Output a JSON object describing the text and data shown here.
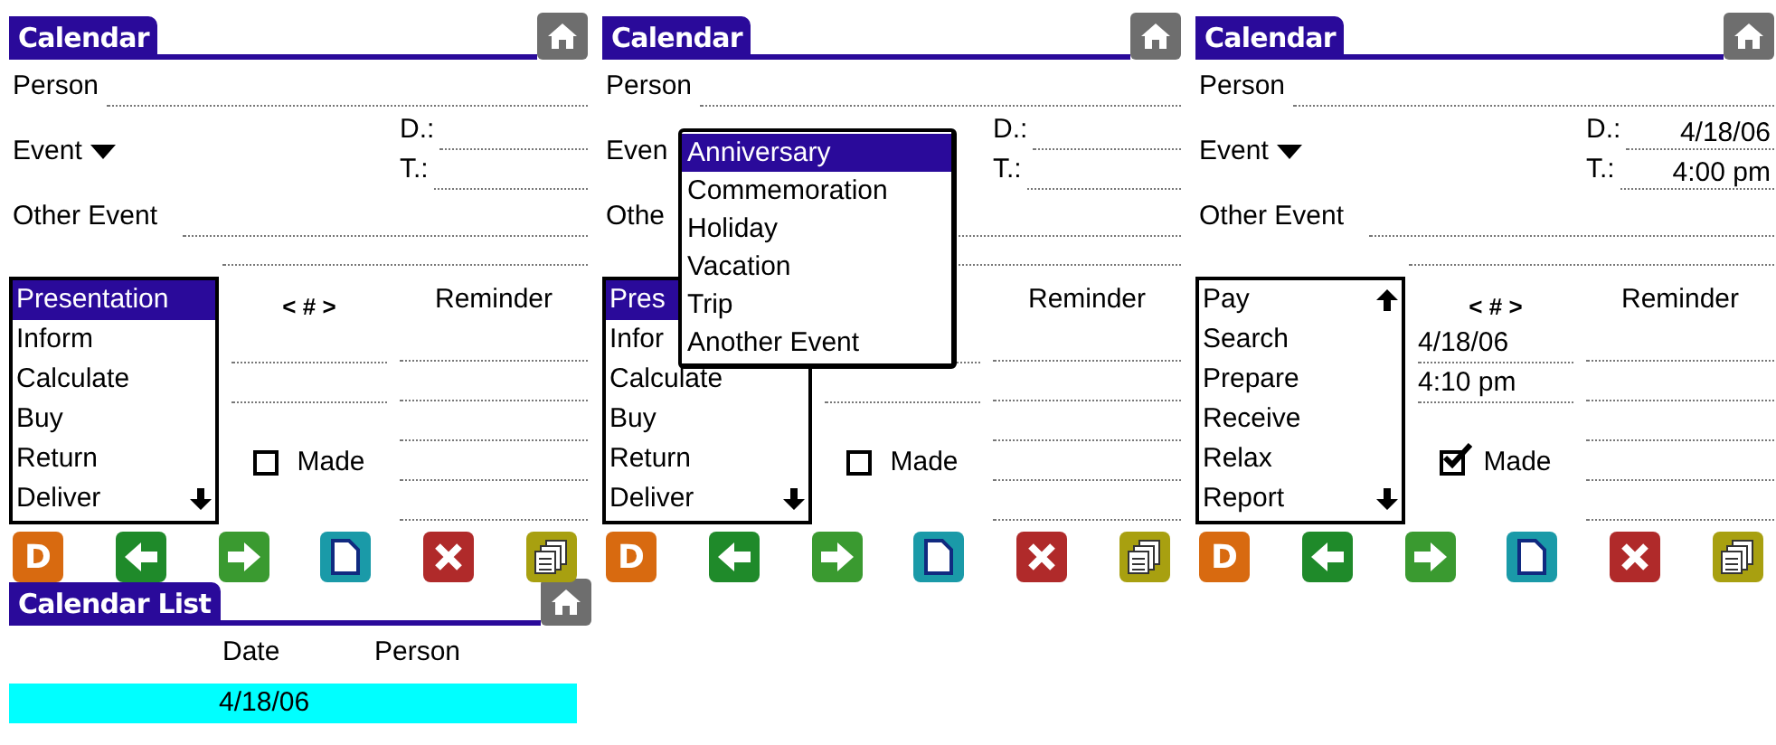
{
  "panels": [
    {
      "title": "Calendar",
      "person_label": "Person",
      "event_label": "Event",
      "event_arrow": true,
      "date_label": "D.:",
      "time_label": "T.:",
      "other_event_label": "Other Event",
      "counter": "< # >",
      "reminder_label": "Reminder",
      "made": {
        "label": "Made",
        "checked": false
      },
      "list": {
        "scroll_up": false,
        "scroll_down": true,
        "items": [
          {
            "label": "Presentation",
            "selected": true
          },
          {
            "label": "Inform",
            "selected": false
          },
          {
            "label": "Calculate",
            "selected": false
          },
          {
            "label": "Buy",
            "selected": false
          },
          {
            "label": "Return",
            "selected": false
          },
          {
            "label": "Deliver",
            "selected": false
          }
        ]
      }
    },
    {
      "title": "Calendar",
      "person_label": "Person",
      "event_label": "Even",
      "event_arrow": false,
      "date_label": "D.:",
      "time_label": "T.:",
      "other_event_label": "Othe",
      "reminder_label": "Reminder",
      "made": {
        "label": "Made",
        "checked": false
      },
      "list": {
        "scroll_up": false,
        "scroll_down": true,
        "items": [
          {
            "label": "Pres",
            "selected": true
          },
          {
            "label": "Infor",
            "selected": false
          },
          {
            "label": "Calculate",
            "selected": false
          },
          {
            "label": "Buy",
            "selected": false
          },
          {
            "label": "Return",
            "selected": false
          },
          {
            "label": "Deliver",
            "selected": false
          }
        ]
      },
      "popup": [
        {
          "label": "Anniversary",
          "selected": true
        },
        {
          "label": "Commemoration",
          "selected": false
        },
        {
          "label": "Holiday",
          "selected": false
        },
        {
          "label": "Vacation",
          "selected": false
        },
        {
          "label": "Trip",
          "selected": false
        },
        {
          "label": "Another Event",
          "selected": false
        }
      ]
    },
    {
      "title": "Calendar",
      "person_label": "Person",
      "event_label": "Event",
      "event_arrow": true,
      "date_label": "D.:",
      "date_value": "4/18/06",
      "time_label": "T.:",
      "time_value": "4:00 pm",
      "other_event_label": "Other Event",
      "counter": "< # >",
      "alarm_date": "4/18/06",
      "alarm_time": "4:10 pm",
      "reminder_label": "Reminder",
      "made": {
        "label": "Made",
        "checked": true
      },
      "list": {
        "scroll_up": true,
        "scroll_down": true,
        "items": [
          {
            "label": "Pay",
            "selected": false
          },
          {
            "label": "Search",
            "selected": false
          },
          {
            "label": "Prepare",
            "selected": false
          },
          {
            "label": "Receive",
            "selected": false
          },
          {
            "label": "Relax",
            "selected": false
          },
          {
            "label": "Report",
            "selected": false
          }
        ]
      }
    }
  ],
  "toolbars": [
    [
      {
        "kind": "details",
        "label": "D"
      },
      {
        "kind": "back"
      },
      {
        "kind": "forward"
      },
      {
        "kind": "new"
      },
      {
        "kind": "delete"
      },
      {
        "kind": "copy"
      }
    ],
    [
      {
        "kind": "details",
        "label": "D"
      },
      {
        "kind": "back"
      },
      {
        "kind": "forward"
      },
      {
        "kind": "new"
      },
      {
        "kind": "delete"
      },
      {
        "kind": "copy"
      }
    ],
    [
      {
        "kind": "details",
        "label": "D"
      },
      {
        "kind": "back"
      },
      {
        "kind": "forward"
      },
      {
        "kind": "new"
      },
      {
        "kind": "delete"
      },
      {
        "kind": "copy"
      }
    ]
  ],
  "calendar_list": {
    "title": "Calendar List",
    "columns": [
      "Date",
      "Person"
    ],
    "rows": [
      {
        "date": "4/18/06",
        "selected": true
      }
    ]
  }
}
